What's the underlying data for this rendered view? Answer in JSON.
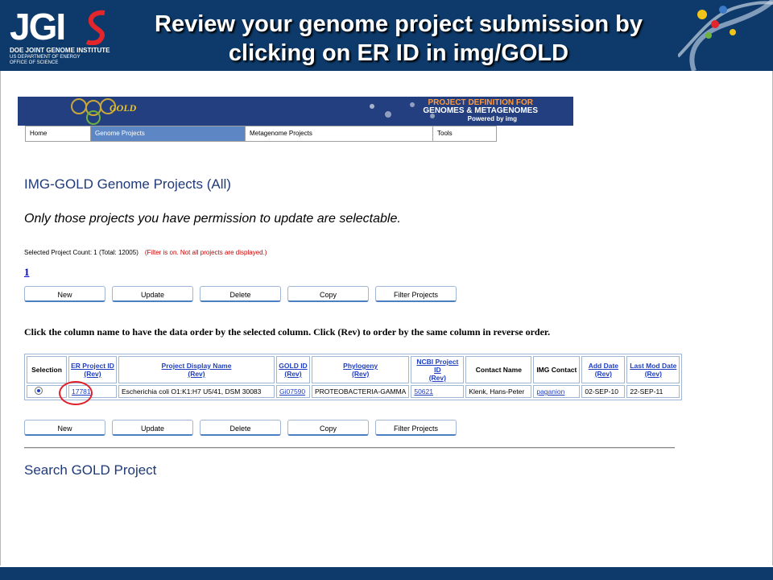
{
  "slide": {
    "title_line1": "Review your genome project submission by",
    "title_line2": "clicking on ER ID in img/GOLD",
    "logo": {
      "wordmark": "JGI",
      "line1": "DOE JOINT GENOME INSTITUTE",
      "line2": "US DEPARTMENT OF ENERGY",
      "line3": "OFFICE OF SCIENCE"
    },
    "header_color": "#0d3a6a"
  },
  "banner": {
    "gold_label": "GOLD",
    "right_line1": "PROJECT DEFINITION FOR",
    "right_line2": "GENOMES & METAGENOMES",
    "right_line3": "Powered by img"
  },
  "nav": {
    "tabs": [
      "Home",
      "Genome Projects",
      "Metagenome Projects",
      "Tools"
    ],
    "active": "Genome Projects"
  },
  "page": {
    "heading": "IMG-GOLD Genome Projects (All)",
    "permission_note": "Only those projects you have permission to update are selectable.",
    "count_text": "Selected Project Count: 1 (Total: 12005)",
    "filter_text": "(Filter is on. Not all projects are displayed.)",
    "page_number": "1",
    "instruction": "Click the column name to have the data order by the selected column. Click (Rev) to order by the same column in reverse order.",
    "search_heading": "Search GOLD Project"
  },
  "buttons": {
    "new": "New",
    "update": "Update",
    "delete": "Delete",
    "copy": "Copy",
    "filter": "Filter Projects"
  },
  "table": {
    "rev_label": "(Rev)",
    "headers": {
      "selection": "Selection",
      "er_id": "ER Project ID",
      "display_name": "Project Display Name",
      "gold_id": "GOLD ID",
      "phylogeny": "Phylogeny",
      "ncbi_id": "NCBI Project ID",
      "contact": "Contact Name",
      "img_contact": "IMG Contact",
      "add_date": "Add Date",
      "mod_date": "Last Mod Date"
    },
    "row": {
      "er_id": "17781",
      "display_name": "Escherichia coli O1:K1:H7 U5/41, DSM 30083",
      "gold_id": "Gi07590",
      "phylogeny": "PROTEOBACTERIA-GAMMA",
      "ncbi_id": "50621",
      "contact": "Klenk, Hans-Peter",
      "img_contact": "paganion",
      "add_date": "02-SEP-10",
      "mod_date": "22-SEP-11"
    }
  }
}
